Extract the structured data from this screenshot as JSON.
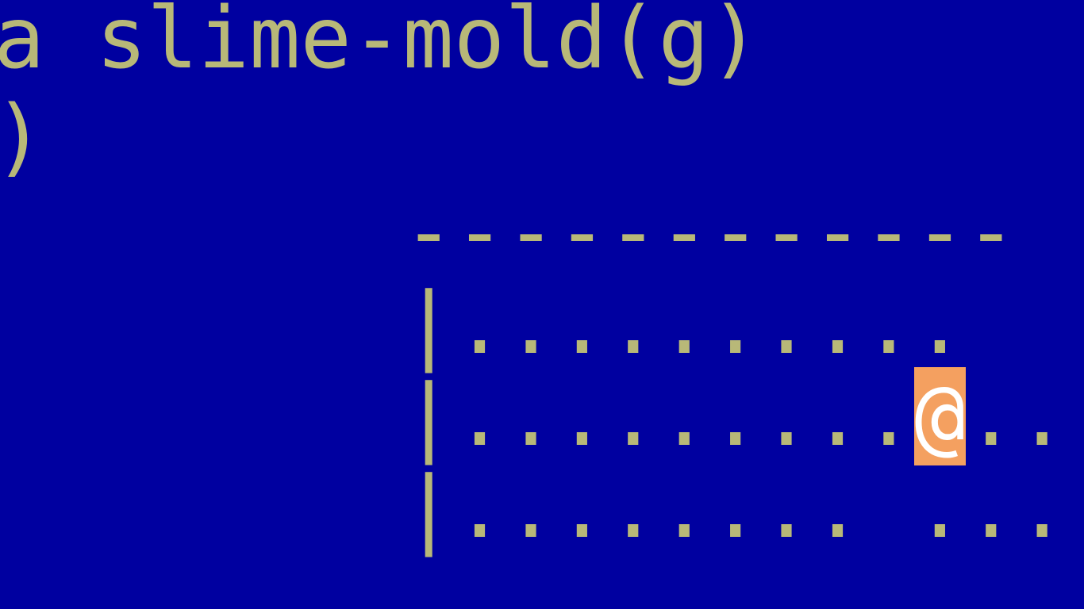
{
  "messages": {
    "line1": "a slime-mold(g)",
    "line2": ")"
  },
  "map": {
    "row1": "------------",
    "row2": "|..........",
    "row3_before": "|.........",
    "row3_player": "@",
    "row3_after": "..",
    "row4": "|........ ..."
  },
  "colors": {
    "background": "#0000a0",
    "text": "#b8b878",
    "player_highlight": "#f4a060"
  }
}
